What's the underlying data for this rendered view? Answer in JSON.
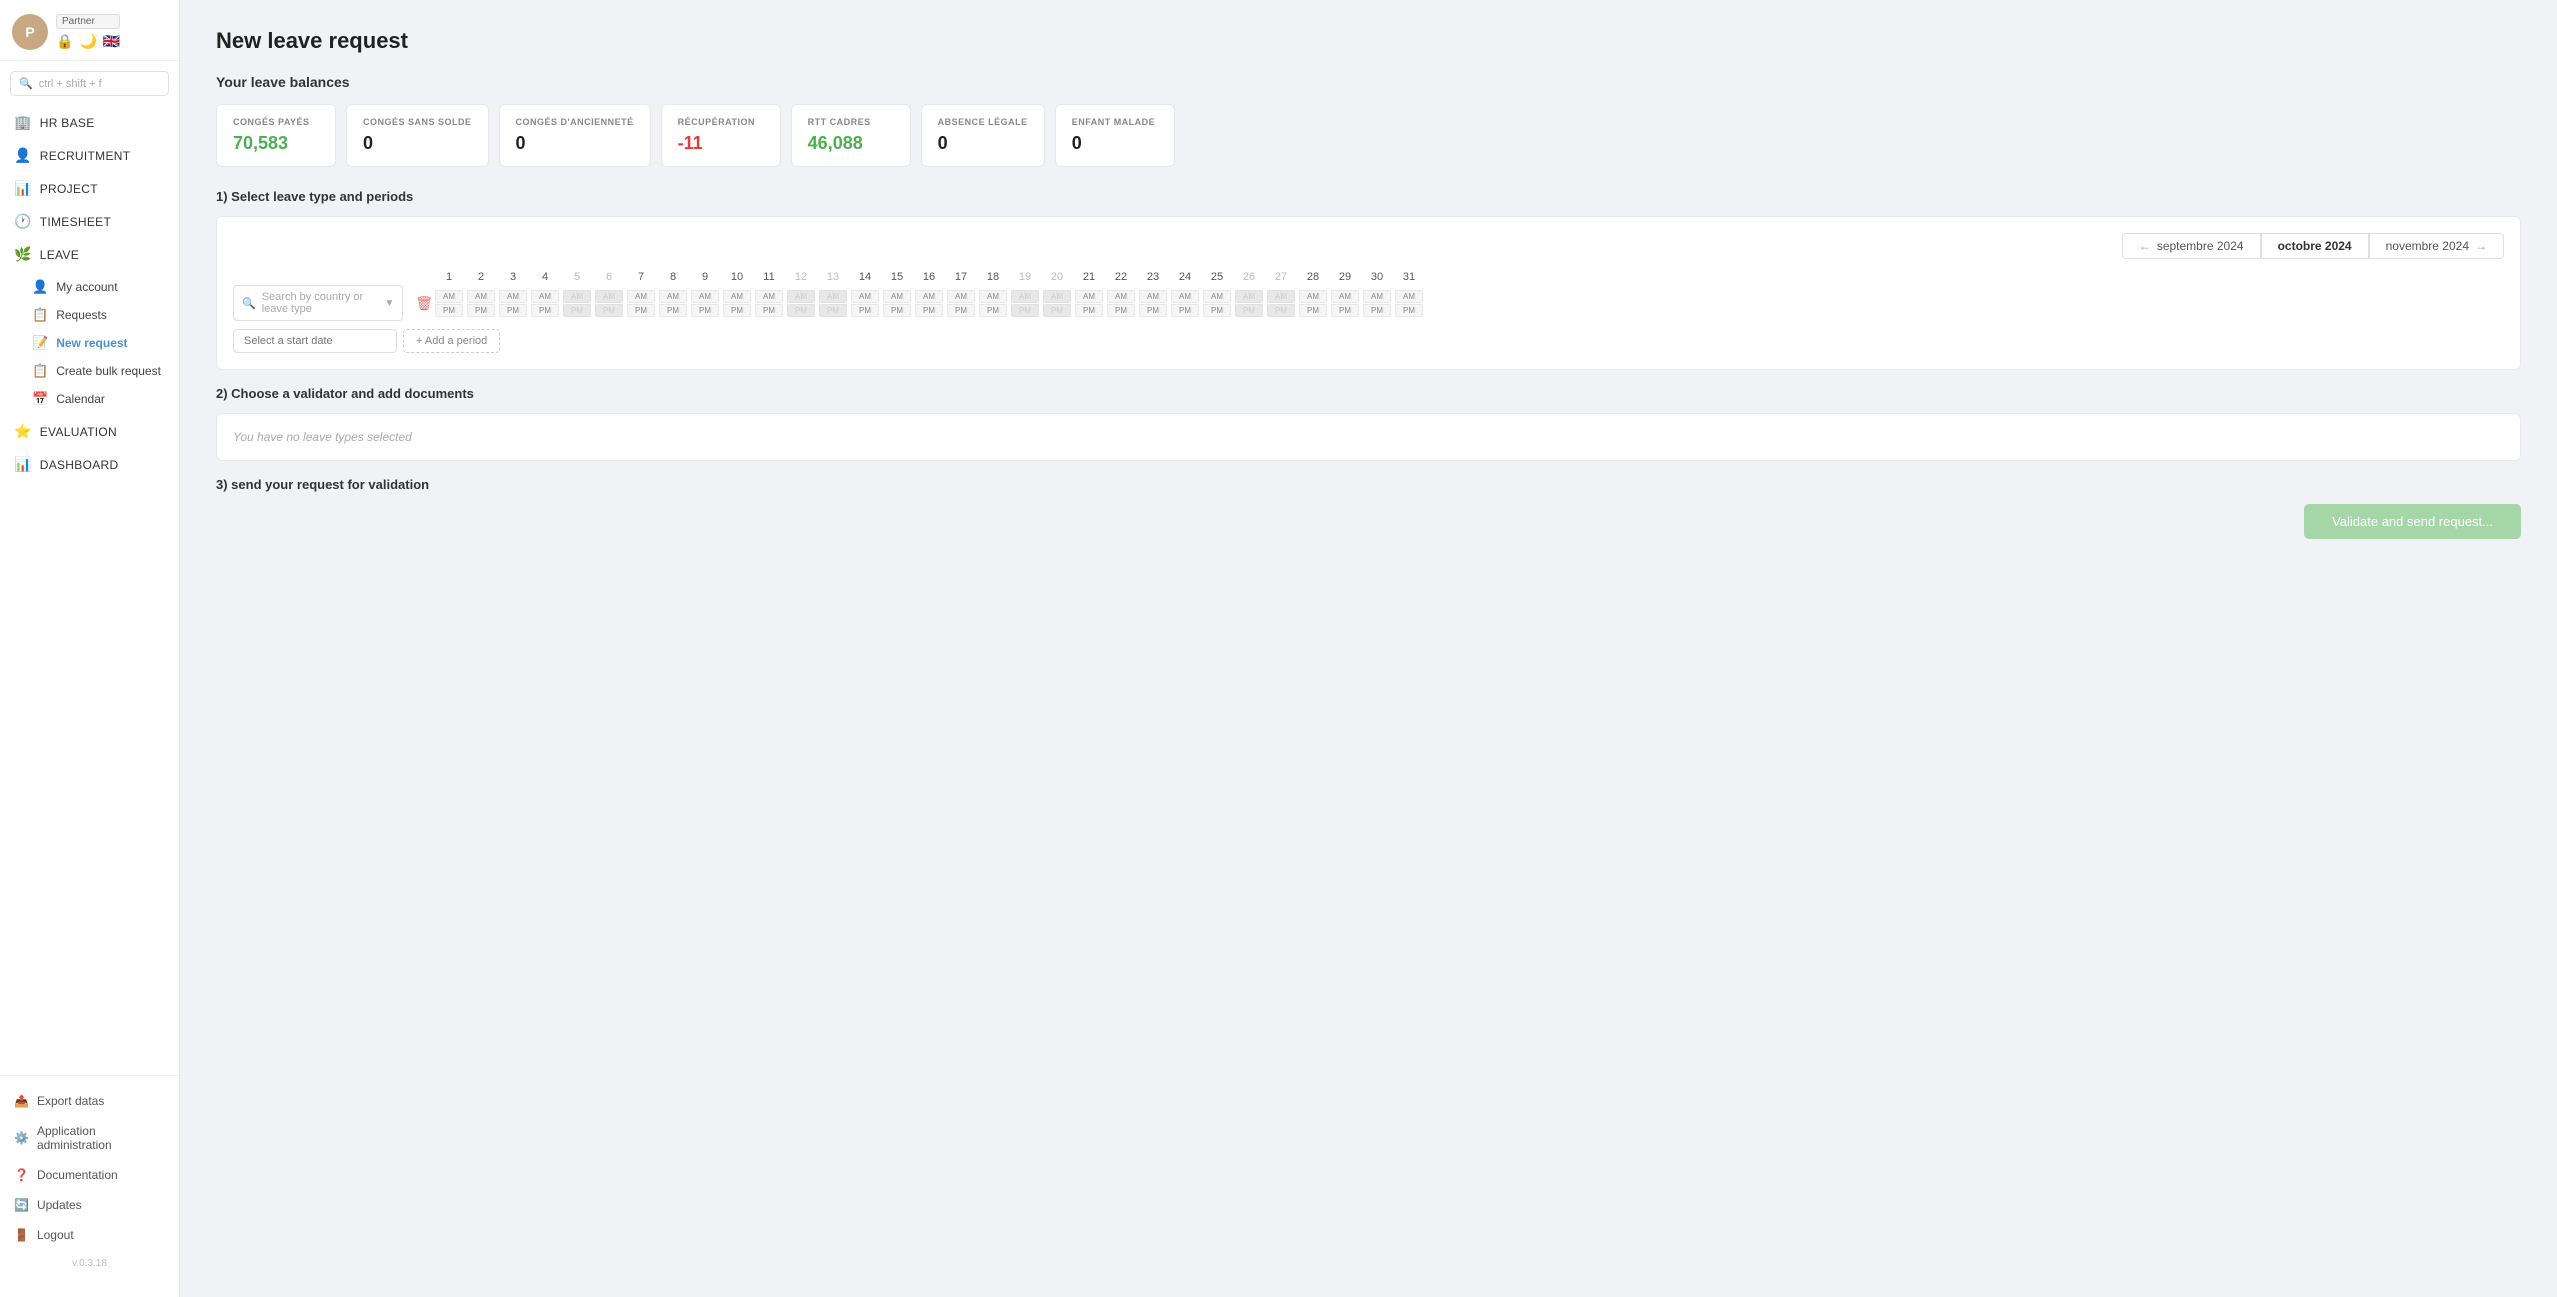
{
  "sidebar": {
    "user": {
      "avatar_initials": "P",
      "badge": "Partner"
    },
    "search_placeholder": "ctrl + shift + f",
    "nav_items": [
      {
        "id": "hr-base",
        "label": "HR BASE",
        "icon": "🏢"
      },
      {
        "id": "recruitment",
        "label": "RECRUITMENT",
        "icon": "👤"
      },
      {
        "id": "project",
        "label": "PROJECT",
        "icon": "📊"
      },
      {
        "id": "timesheet",
        "label": "TIMESHEET",
        "icon": "🕐"
      },
      {
        "id": "leave",
        "label": "LEAVE",
        "icon": "🌿"
      }
    ],
    "leave_subnav": [
      {
        "id": "my-account",
        "label": "My account",
        "icon": "👤"
      },
      {
        "id": "requests",
        "label": "Requests",
        "icon": "📋"
      },
      {
        "id": "new-request",
        "label": "New request",
        "icon": "📝",
        "active": true
      },
      {
        "id": "create-bulk-request",
        "label": "Create bulk request",
        "icon": "📋"
      },
      {
        "id": "calendar",
        "label": "Calendar",
        "icon": "📅"
      }
    ],
    "other_nav": [
      {
        "id": "evaluation",
        "label": "EVALUATION",
        "icon": "⭐"
      },
      {
        "id": "dashboard",
        "label": "DASHBOARD",
        "icon": "📊"
      }
    ],
    "bottom_items": [
      {
        "id": "export-datas",
        "label": "Export datas",
        "icon": "📤"
      },
      {
        "id": "application-administration",
        "label": "Application administration",
        "icon": "⚙️"
      },
      {
        "id": "documentation",
        "label": "Documentation",
        "icon": "❓"
      },
      {
        "id": "updates",
        "label": "Updates",
        "icon": "🔄"
      },
      {
        "id": "logout",
        "label": "Logout",
        "icon": "🚪"
      }
    ],
    "version": "v.0.3.18"
  },
  "main": {
    "page_title": "New leave request",
    "balances_title": "Your leave balances",
    "balances": [
      {
        "id": "conges-payes",
        "label": "CONGÉS PAYÉS",
        "value": "70,583",
        "color": "green"
      },
      {
        "id": "conges-sans-solde",
        "label": "CONGÉS SANS SOLDE",
        "value": "0",
        "color": "black"
      },
      {
        "id": "conges-anciennete",
        "label": "CONGÉS D'ANCIENNETÉ",
        "value": "0",
        "color": "black"
      },
      {
        "id": "recuperation",
        "label": "RÉCUPÉRATION",
        "value": "-11",
        "color": "red"
      },
      {
        "id": "rtt-cadres",
        "label": "RTT CADRES",
        "value": "46,088",
        "color": "green"
      },
      {
        "id": "absence-legale",
        "label": "ABSENCE LÉGALE",
        "value": "0",
        "color": "black"
      },
      {
        "id": "enfant-malade",
        "label": "ENFANT MALADE",
        "value": "0",
        "color": "black"
      }
    ],
    "section1_title": "1) Select leave type and periods",
    "calendar": {
      "prev_month": "septembre 2024",
      "current_month": "octobre 2024",
      "next_month": "novembre 2024",
      "days": [
        1,
        2,
        3,
        4,
        5,
        6,
        7,
        8,
        9,
        10,
        11,
        12,
        13,
        14,
        15,
        16,
        17,
        18,
        19,
        20,
        21,
        22,
        23,
        24,
        25,
        26,
        27,
        28,
        29,
        30,
        31
      ],
      "weekends": [
        5,
        6,
        12,
        13,
        19,
        20,
        26,
        27
      ],
      "search_placeholder": "Search by country or leave type",
      "start_date_placeholder": "Select a start date",
      "add_period_label": "+ Add a period"
    },
    "section2_title": "2) Choose a validator and add documents",
    "no_leave_msg": "You have no leave types selected",
    "section3_title": "3) send your request for validation",
    "validate_btn_label": "Validate and send request..."
  }
}
